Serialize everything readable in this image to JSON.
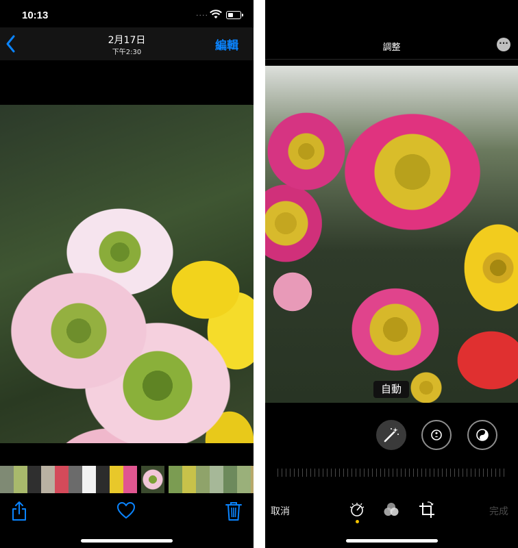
{
  "left_screen": {
    "status": {
      "time": "10:13",
      "signal": "····"
    },
    "header": {
      "date": "2月17日",
      "time": "下午2:30",
      "edit_label": "編輯"
    },
    "thumbnails": [
      "#7f8a74",
      "#a8b96c",
      "#2f2f2f",
      "#b9b1a2",
      "#d44a5a",
      "#6b6b6b",
      "#f2f2f2",
      "#2c2c2c",
      "#e9e4dc",
      "#e8c82a",
      "#e05690",
      "#a0a08a",
      "#7b9c52",
      "#c7c24a",
      "#8fa36a",
      "#a6b898",
      "#6d8a5c",
      "#9ab07a",
      "#b8a86a",
      "#8ea07a"
    ],
    "toolbar": {
      "share": "share-icon",
      "favorite": "heart-icon",
      "delete": "trash-icon"
    }
  },
  "right_screen": {
    "header": {
      "title": "調整",
      "more": "···"
    },
    "photo_label": "自動",
    "adjust_controls": [
      "magic-wand-icon",
      "exposure-icon",
      "brilliance-icon"
    ],
    "bottom": {
      "cancel_label": "取消",
      "done_label": "完成",
      "tools": [
        "adjust-dial-icon",
        "filters-icon",
        "crop-rotate-icon"
      ]
    }
  },
  "colors": {
    "accent": "#0a84ff",
    "tool_active": "#f5c400",
    "background": "#000000"
  }
}
